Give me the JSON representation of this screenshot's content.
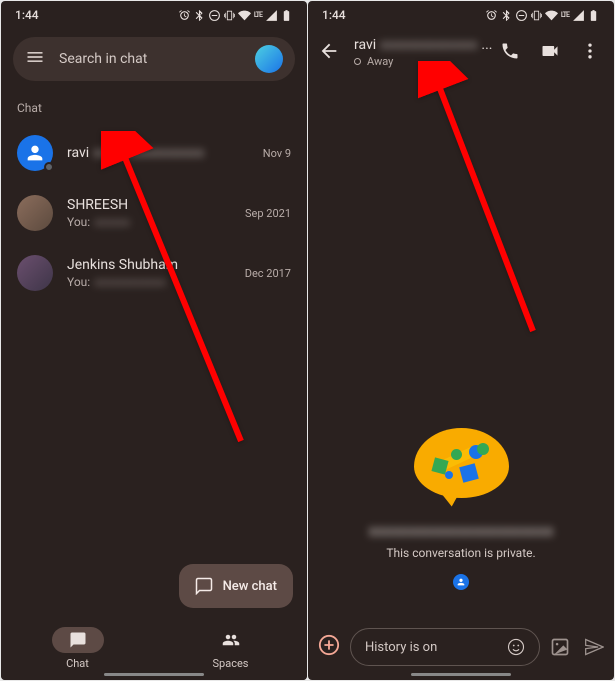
{
  "statusBar": {
    "time": "1:44"
  },
  "left": {
    "search": {
      "placeholder": "Search in chat"
    },
    "sectionLabel": "Chat",
    "items": [
      {
        "name": "ravi",
        "blurredSuffix": "xxxxxxxxxxxxxxxx",
        "time": "Nov 9",
        "previewYou": "",
        "preview": ""
      },
      {
        "name": "SHREESH",
        "time": "Sep 2021",
        "previewYou": "You:",
        "preview": "xxxxxx"
      },
      {
        "name": "Jenkins Shubham",
        "time": "Dec 2017",
        "previewYou": "You:",
        "preview": "xxxxxxxxxxxx"
      }
    ],
    "fab": "New chat",
    "nav": {
      "chat": "Chat",
      "spaces": "Spaces"
    }
  },
  "right": {
    "header": {
      "name": "ravi",
      "blurredSuffix": "xxxxxxxxxxxxxx",
      "suffix": "...",
      "status": "Away"
    },
    "welcome": {
      "privateMsg": "This conversation is private."
    },
    "compose": {
      "placeholder": "History is on"
    }
  }
}
